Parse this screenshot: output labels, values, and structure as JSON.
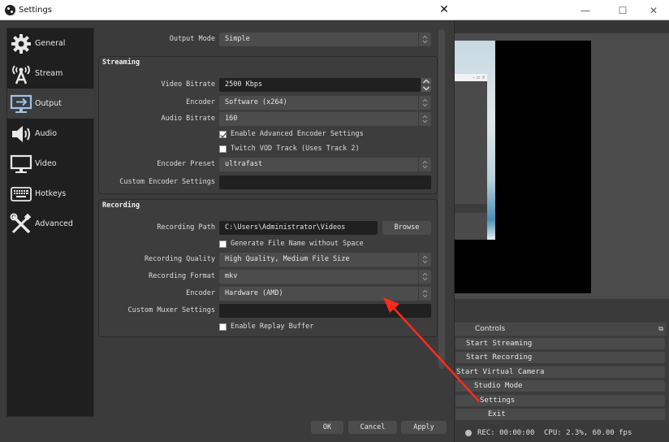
{
  "main_window": {
    "controls": {
      "title": "Controls",
      "buttons": [
        "Start Streaming",
        "Start Recording",
        "Start Virtual Camera",
        "Studio Mode",
        "Settings",
        "Exit"
      ]
    },
    "status": {
      "rec": "REC: 00:00:00",
      "cpu": "CPU: 2.3%, 60.00 fps"
    },
    "window_buttons": {
      "minimize": "—",
      "maximize": "☐",
      "close": "✕"
    },
    "preview_mini_window_buttons": "–  ▫  ×"
  },
  "settings": {
    "title": "Settings",
    "close_glyph": "✕",
    "sidebar": {
      "items": [
        {
          "label": "General",
          "icon": "gear-icon"
        },
        {
          "label": "Stream",
          "icon": "broadcast-antenna-icon"
        },
        {
          "label": "Output",
          "icon": "output-monitor-icon",
          "active": true
        },
        {
          "label": "Audio",
          "icon": "speaker-icon"
        },
        {
          "label": "Video",
          "icon": "monitor-icon"
        },
        {
          "label": "Hotkeys",
          "icon": "keyboard-icon"
        },
        {
          "label": "Advanced",
          "icon": "wrench-screwdriver-icon"
        }
      ]
    },
    "output_mode": {
      "label": "Output Mode",
      "value": "Simple"
    },
    "streaming": {
      "title": "Streaming",
      "video_bitrate": {
        "label": "Video Bitrate",
        "value": "2500 Kbps"
      },
      "encoder": {
        "label": "Encoder",
        "value": "Software (x264)"
      },
      "audio_bitrate": {
        "label": "Audio Bitrate",
        "value": "160"
      },
      "enable_advanced": {
        "label": "Enable Advanced Encoder Settings",
        "checked": true
      },
      "twitch_vod": {
        "label": "Twitch VOD Track (Uses Track 2)",
        "checked": false
      },
      "encoder_preset": {
        "label": "Encoder Preset",
        "value": "ultrafast"
      },
      "custom_encoder_settings": {
        "label": "Custom Encoder Settings",
        "value": ""
      }
    },
    "recording": {
      "title": "Recording",
      "path": {
        "label": "Recording Path",
        "value": "C:\\Users\\Administrator\\Videos"
      },
      "browse": "Browse",
      "generate_name": {
        "label": "Generate File Name without Space",
        "checked": false
      },
      "quality": {
        "label": "Recording Quality",
        "value": "High Quality, Medium File Size"
      },
      "format": {
        "label": "Recording Format",
        "value": "mkv"
      },
      "encoder": {
        "label": "Encoder",
        "value": "Hardware (AMD)"
      },
      "custom_muxer": {
        "label": "Custom Muxer Settings",
        "value": ""
      },
      "replay_buffer": {
        "label": "Enable Replay Buffer",
        "checked": false
      }
    },
    "buttons": {
      "ok": "OK",
      "cancel": "Cancel",
      "apply": "Apply"
    }
  },
  "annotation": {
    "color": "#ff2a1a"
  }
}
